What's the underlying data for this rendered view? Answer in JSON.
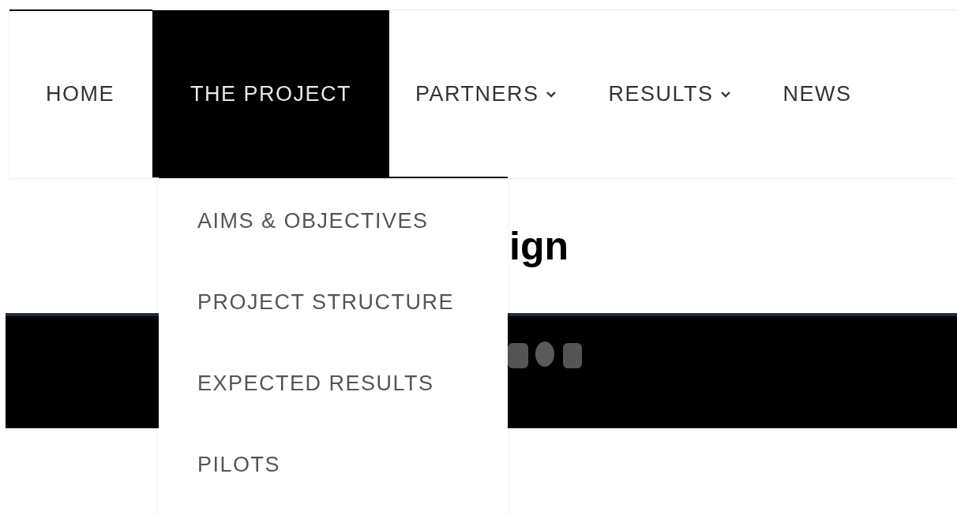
{
  "nav": {
    "items": [
      {
        "label": "HOME",
        "selected": false,
        "has_dropdown": false
      },
      {
        "label": "THE PROJECT",
        "selected": true,
        "has_dropdown": false
      },
      {
        "label": "PARTNERS",
        "selected": false,
        "has_dropdown": true
      },
      {
        "label": "RESULTS",
        "selected": false,
        "has_dropdown": true
      },
      {
        "label": "NEWS",
        "selected": false,
        "has_dropdown": false
      }
    ]
  },
  "dropdown": {
    "items": [
      {
        "label": "AIMS & OBJECTIVES"
      },
      {
        "label": "PROJECT STRUCTURE"
      },
      {
        "label": "EXPECTED RESULTS"
      },
      {
        "label": "PILOTS"
      }
    ]
  },
  "heading": "ign"
}
